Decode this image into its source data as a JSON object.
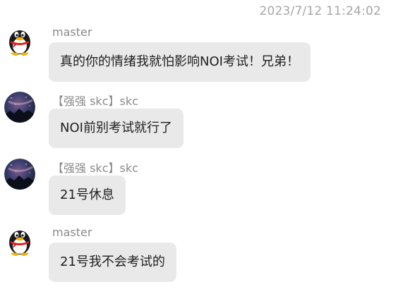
{
  "timestamp": "2023/7/12 11:24:02",
  "messages": [
    {
      "sender": "master",
      "avatar": "qq-penguin-icon",
      "text": "真的你的情绪我就怕影响NOI考试！兄弟！"
    },
    {
      "sender": "【强强 skc】skc",
      "avatar": "night-sky-avatar",
      "text": "NOI前别考试就行了"
    },
    {
      "sender": "【强强 skc】skc",
      "avatar": "night-sky-avatar",
      "text": "21号休息"
    },
    {
      "sender": "master",
      "avatar": "qq-penguin-icon",
      "text": "21号我不会考试的"
    }
  ],
  "colors": {
    "bubble_bg": "#e9e9e9",
    "sender_text": "#8a8a8a",
    "timestamp_text": "#a6a6a6"
  }
}
